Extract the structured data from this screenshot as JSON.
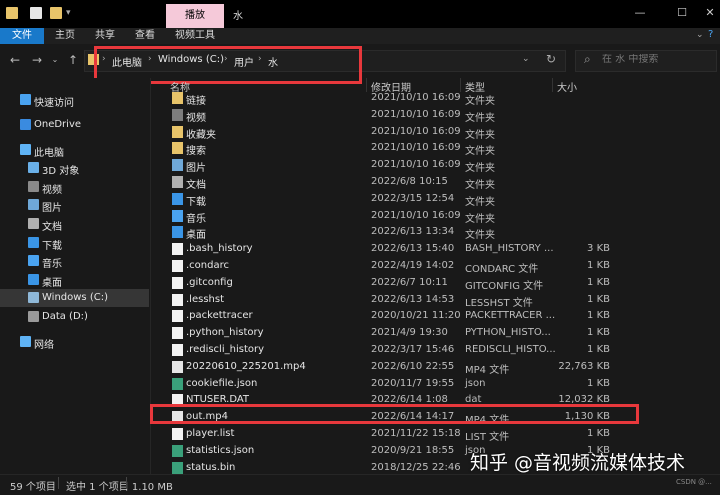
{
  "window": {
    "title": "水",
    "context_tab": "播放",
    "min_glyph": "—",
    "max_glyph": "☐",
    "close_glyph": "✕"
  },
  "ribbon": {
    "tabs": [
      "文件",
      "主页",
      "共享",
      "查看",
      "视频工具"
    ]
  },
  "address": {
    "crumbs": [
      "此电脑",
      "Windows (C:)",
      "用户",
      "水"
    ],
    "search_placeholder": "在 水 中搜索"
  },
  "sidebar": {
    "items": [
      {
        "label": "快速访问",
        "icon": "star-icon",
        "color": "#4aa3f0"
      },
      {
        "label": "OneDrive",
        "icon": "cloud-icon",
        "color": "#3a8be0"
      },
      {
        "label": "此电脑",
        "icon": "pc-icon",
        "color": "#5fb3f5"
      },
      {
        "label": "3D 对象",
        "icon": "cube-icon",
        "color": "#6ab0e8"
      },
      {
        "label": "视频",
        "icon": "video-icon",
        "color": "#8a8a8a"
      },
      {
        "label": "图片",
        "icon": "picture-icon",
        "color": "#6fa8d8"
      },
      {
        "label": "文档",
        "icon": "document-icon",
        "color": "#b0b0b0"
      },
      {
        "label": "下载",
        "icon": "download-icon",
        "color": "#3a95e6"
      },
      {
        "label": "音乐",
        "icon": "music-icon",
        "color": "#4aa3f0"
      },
      {
        "label": "桌面",
        "icon": "desktop-icon",
        "color": "#3a95e6"
      },
      {
        "label": "Windows (C:)",
        "icon": "drive-icon",
        "color": "#8fb8d8"
      },
      {
        "label": "Data (D:)",
        "icon": "drive-icon",
        "color": "#9a9a9a"
      },
      {
        "label": "网络",
        "icon": "network-icon",
        "color": "#5fb3f5"
      }
    ]
  },
  "columns": {
    "name": "名称",
    "date": "修改日期",
    "type": "类型",
    "size": "大小"
  },
  "files": [
    {
      "name": "链接",
      "date": "2021/10/10 16:09",
      "type": "文件夹",
      "size": "",
      "icon": "link-folder-icon",
      "color": "#e8c46a"
    },
    {
      "name": "视频",
      "date": "2021/10/10 16:09",
      "type": "文件夹",
      "size": "",
      "icon": "video-icon",
      "color": "#7d7d7d"
    },
    {
      "name": "收藏夹",
      "date": "2021/10/10 16:09",
      "type": "文件夹",
      "size": "",
      "icon": "favorites-icon",
      "color": "#e8c46a"
    },
    {
      "name": "搜索",
      "date": "2021/10/10 16:09",
      "type": "文件夹",
      "size": "",
      "icon": "search-folder-icon",
      "color": "#e8c46a"
    },
    {
      "name": "图片",
      "date": "2021/10/10 16:09",
      "type": "文件夹",
      "size": "",
      "icon": "picture-icon",
      "color": "#6fa8d8"
    },
    {
      "name": "文档",
      "date": "2022/6/8 10:15",
      "type": "文件夹",
      "size": "",
      "icon": "document-icon",
      "color": "#b0b0b0"
    },
    {
      "name": "下载",
      "date": "2022/3/15 12:54",
      "type": "文件夹",
      "size": "",
      "icon": "download-icon",
      "color": "#3a95e6"
    },
    {
      "name": "音乐",
      "date": "2021/10/10 16:09",
      "type": "文件夹",
      "size": "",
      "icon": "music-icon",
      "color": "#4aa3f0"
    },
    {
      "name": "桌面",
      "date": "2022/6/13 13:34",
      "type": "文件夹",
      "size": "",
      "icon": "desktop-icon",
      "color": "#3a95e6"
    },
    {
      "name": ".bash_history",
      "date": "2022/6/13 15:40",
      "type": "BASH_HISTORY ...",
      "size": "3 KB",
      "icon": "file-icon",
      "color": "#f2f2f2"
    },
    {
      "name": ".condarc",
      "date": "2022/4/19 14:02",
      "type": "CONDARC 文件",
      "size": "1 KB",
      "icon": "file-icon",
      "color": "#f2f2f2"
    },
    {
      "name": ".gitconfig",
      "date": "2022/6/7 10:11",
      "type": "GITCONFIG 文件",
      "size": "1 KB",
      "icon": "file-icon",
      "color": "#f2f2f2"
    },
    {
      "name": ".lesshst",
      "date": "2022/6/13 14:53",
      "type": "LESSHST 文件",
      "size": "1 KB",
      "icon": "file-icon",
      "color": "#f2f2f2"
    },
    {
      "name": ".packettracer",
      "date": "2020/10/21 11:20",
      "type": "PACKETTRACER ...",
      "size": "1 KB",
      "icon": "file-icon",
      "color": "#f2f2f2"
    },
    {
      "name": ".python_history",
      "date": "2021/4/9 19:30",
      "type": "PYTHON_HISTO...",
      "size": "1 KB",
      "icon": "file-icon",
      "color": "#f2f2f2"
    },
    {
      "name": ".rediscli_history",
      "date": "2022/3/17 15:46",
      "type": "REDISCLI_HISTO...",
      "size": "1 KB",
      "icon": "file-icon",
      "color": "#f2f2f2"
    },
    {
      "name": "20220610_225201.mp4",
      "date": "2022/6/10 22:55",
      "type": "MP4 文件",
      "size": "22,763 KB",
      "icon": "video-file-icon",
      "color": "#e6e6e6"
    },
    {
      "name": "cookiefile.json",
      "date": "2020/11/7 19:55",
      "type": "json",
      "size": "1 KB",
      "icon": "json-file-icon",
      "color": "#3aa07a"
    },
    {
      "name": "NTUSER.DAT",
      "date": "2022/6/14 1:08",
      "type": "dat",
      "size": "12,032 KB",
      "icon": "file-icon",
      "color": "#f2f2f2"
    },
    {
      "name": "out.mp4",
      "date": "2022/6/14 14:17",
      "type": "MP4 文件",
      "size": "1,130 KB",
      "icon": "video-file-icon",
      "color": "#e6e6e6"
    },
    {
      "name": "player.list",
      "date": "2021/11/22 15:18",
      "type": "LIST 文件",
      "size": "1 KB",
      "icon": "file-icon",
      "color": "#f2f2f2"
    },
    {
      "name": "statistics.json",
      "date": "2020/9/21 18:55",
      "type": "json",
      "size": "1 KB",
      "icon": "json-file-icon",
      "color": "#3aa07a"
    },
    {
      "name": "status.bin",
      "date": "2018/12/25 22:46",
      "type": "",
      "size": "",
      "icon": "bin-file-icon",
      "color": "#3aa07a"
    }
  ],
  "status": {
    "count": "59 个项目",
    "selected": "选中 1 个项目 1.10 MB"
  },
  "watermark": "知乎 @音视频流媒体技术",
  "csdn": "CSDN @..."
}
